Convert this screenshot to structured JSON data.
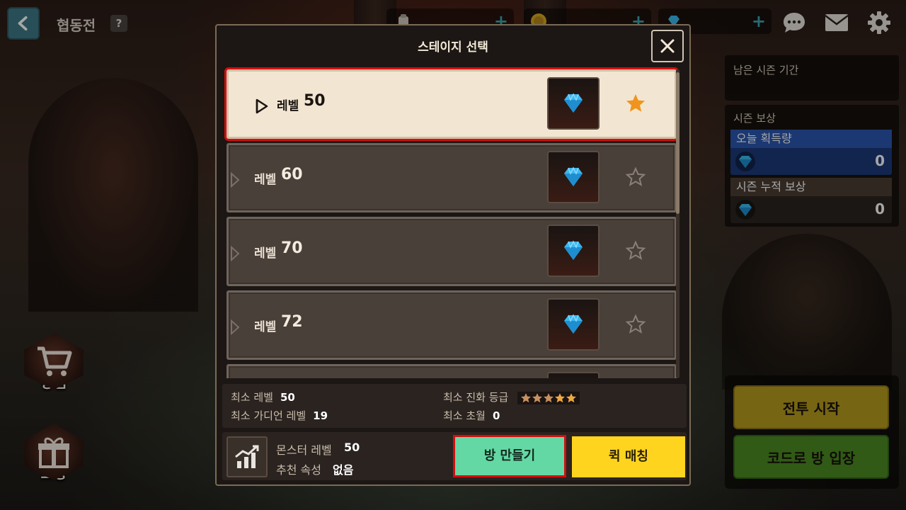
{
  "header": {
    "mode_title": "협동전",
    "help_label": "?"
  },
  "currencies": [
    {
      "icon": "stamina-icon",
      "plus": "+"
    },
    {
      "icon": "gold-coin-icon",
      "plus": "+"
    },
    {
      "icon": "diamond-icon",
      "plus": "+"
    }
  ],
  "side_menu": {
    "shop_label": "상점",
    "reward_label": "보상"
  },
  "season": {
    "remaining_label": "남은 시즌 기간",
    "reward_header": "시즌 보상",
    "today_label": "오늘 획득량",
    "today_value": "0",
    "total_label": "시즌 누적 보상",
    "total_value": "0"
  },
  "actions": {
    "start_label": "전투 시작",
    "code_label": "코드로 방 입장"
  },
  "modal": {
    "title": "스테이지 선택",
    "stages": [
      {
        "label": "레벨",
        "level": "50",
        "selected": true,
        "favorite": true
      },
      {
        "label": "레벨",
        "level": "60",
        "selected": false,
        "favorite": false
      },
      {
        "label": "레벨",
        "level": "70",
        "selected": false,
        "favorite": false
      },
      {
        "label": "레벨",
        "level": "72",
        "selected": false,
        "favorite": false
      }
    ],
    "info": {
      "min_level_label": "최소 레벨",
      "min_level_value": "50",
      "min_guardian_label": "최소 가디언 레벨",
      "min_guardian_value": "19",
      "min_evolution_label": "최소 진화 등급",
      "min_evolution_stars": 5,
      "min_transcend_label": "최소 초월",
      "min_transcend_value": "0"
    },
    "bottom": {
      "monster_level_label": "몬스터 레벨",
      "monster_level_value": "50",
      "recommended_attr_label": "추천 속성",
      "recommended_attr_value": "없음",
      "create_room_label": "방 만들기",
      "quick_match_label": "퀵 매칭"
    }
  },
  "colors": {
    "selected_highlight": "#d20e0e",
    "create_room": "#64d8a4",
    "quick_match": "#ffd41e",
    "start_battle": "#b59c1e",
    "code_entry": "#4a8a22",
    "today_reward": "#2a56b0"
  }
}
